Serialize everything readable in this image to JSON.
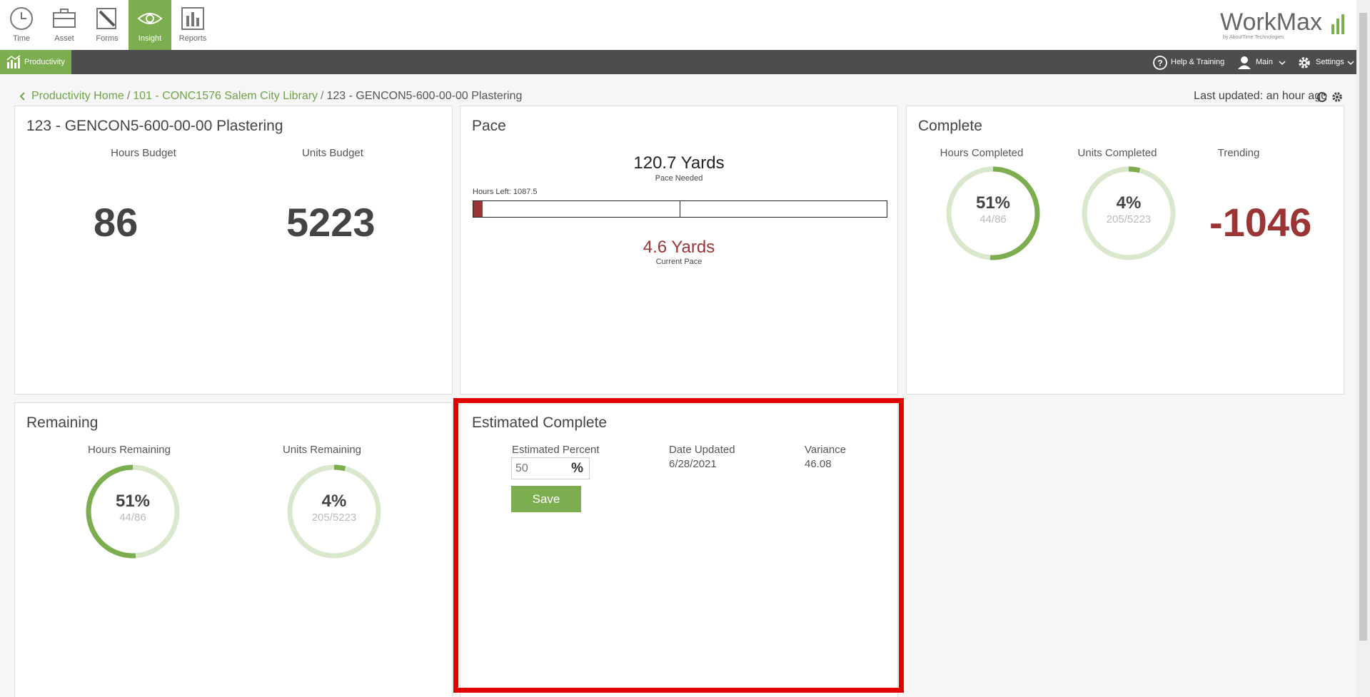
{
  "nav": {
    "items": [
      {
        "label": "Time",
        "icon": "clock-icon"
      },
      {
        "label": "Asset",
        "icon": "briefcase-icon"
      },
      {
        "label": "Forms",
        "icon": "pencil-form-icon"
      },
      {
        "label": "Insight",
        "icon": "eye-icon"
      },
      {
        "label": "Reports",
        "icon": "chart-icon"
      }
    ],
    "brand": "WorkMax",
    "brand_sub": "by AboutTime Technologies"
  },
  "toolbar": {
    "productivity": "Productivity",
    "help": "Help & Training",
    "user": "Main",
    "settings": "Settings"
  },
  "breadcrumb": {
    "home": "Productivity Home",
    "project": "101 - CONC1576 Salem City Library",
    "current": "123 - GENCON5-600-00-00 Plastering"
  },
  "last_updated": "Last updated: an hour ago",
  "budget": {
    "title": "123 - GENCON5-600-00-00 Plastering",
    "hours_label": "Hours Budget",
    "hours_value": "86",
    "units_label": "Units Budget",
    "units_value": "5223"
  },
  "pace": {
    "title": "Pace",
    "needed_value": "120.7 Yards",
    "needed_label": "Pace Needed",
    "hours_left": "Hours Left: 1087.5",
    "current_value": "4.6 Yards",
    "current_label": "Current Pace",
    "bar_fill_fraction": 0.022
  },
  "complete": {
    "title": "Complete",
    "hours_label": "Hours Completed",
    "hours_pct": "51%",
    "hours_frac": "44/86",
    "hours_fraction": 0.51,
    "units_label": "Units Completed",
    "units_pct": "4%",
    "units_frac": "205/5223",
    "units_fraction": 0.04,
    "trending_label": "Trending",
    "trending_value": "-1046"
  },
  "remaining": {
    "title": "Remaining",
    "hours_label": "Hours Remaining",
    "hours_pct": "51%",
    "hours_frac": "44/86",
    "hours_fraction": 0.51,
    "units_label": "Units Remaining",
    "units_pct": "4%",
    "units_frac": "205/5223",
    "units_fraction": 0.04
  },
  "estimated": {
    "title": "Estimated Complete",
    "percent_label": "Estimated Percent",
    "percent_placeholder": "50",
    "percent_sign": "%",
    "date_label": "Date Updated",
    "date_value": "6/28/2021",
    "variance_label": "Variance",
    "variance_value": "46.08",
    "save_label": "Save"
  },
  "colors": {
    "accent": "#7cad4f",
    "accent_light": "#d9e8cc",
    "negative": "#9b3535",
    "highlight": "#e00000"
  }
}
